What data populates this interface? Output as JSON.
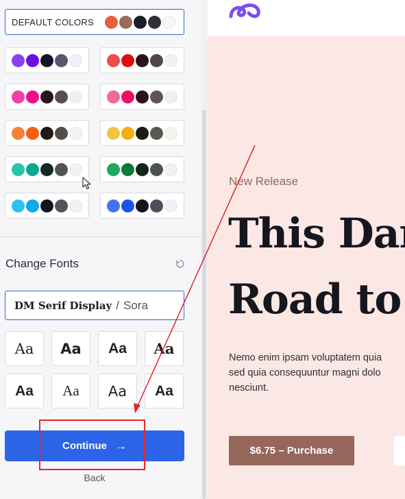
{
  "sidebar": {
    "default_palette": {
      "label": "DEFAULT COLORS",
      "colors": [
        "#e8603a",
        "#9b6a5c",
        "#1d1d2a",
        "#2f2f3a",
        "#fbf6f2"
      ]
    },
    "palettes": [
      [
        "#8a3ff0",
        "#6a0ee3",
        "#14142a",
        "#5a5470",
        "#f1eff8"
      ],
      [
        "#ee4b4b",
        "#dc0e0e",
        "#2a141a",
        "#4e4747",
        "#f4f0f0"
      ],
      [
        "#ef3faa",
        "#ee0f8a",
        "#2a1420",
        "#575052",
        "#f3eff1"
      ],
      [
        "#f06b98",
        "#ee0f6a",
        "#2a141c",
        "#5d5458",
        "#f3eff1"
      ],
      [
        "#f5803a",
        "#f55e0e",
        "#201a14",
        "#544e4a",
        "#f6f2ef"
      ],
      [
        "#f2c440",
        "#f5ae0e",
        "#1e1a14",
        "#5a5752",
        "#f6f4ee"
      ],
      [
        "#28c4a6",
        "#0ba88e",
        "#142a22",
        "#4f5553",
        "#eff3f1"
      ],
      [
        "#1fa85e",
        "#0a7a3a",
        "#14241a",
        "#4c544e",
        "#eff3ef"
      ],
      [
        "#2fc0f2",
        "#0ea8ea",
        "#14141e",
        "#525558",
        "#eef3f5"
      ],
      [
        "#4573f0",
        "#1e50eb",
        "#14141e",
        "#4e4e58",
        "#f0f1f6"
      ]
    ],
    "fonts_section": {
      "title": "Change Fonts",
      "selected_primary": "DM Serif Display",
      "selected_separator": "/",
      "selected_secondary": "Sora",
      "sample_text": "Aa"
    },
    "continue_label": "Continue",
    "continue_arrow": "→",
    "back_label": "Back"
  },
  "preview": {
    "eyebrow": "New Release",
    "headline_line1": "This Dar",
    "headline_line2": "Road to I",
    "body_line1": "Nemo enim ipsam voluptatem quia",
    "body_line2": "sed quia consequuntur magni dolo",
    "body_line3": "nesciunt.",
    "purchase_label": "$6.75 – Purchase"
  },
  "colors": {
    "accent_blue": "#2b64e6",
    "annotation_red": "#e0262b",
    "preview_bg": "#fbe8e4",
    "purchase_bg": "#94675a"
  },
  "icons": {
    "reset": "reset-icon",
    "collapse": "chevron-left-icon",
    "logo": "logo-icon",
    "cursor": "mouse-cursor-icon"
  }
}
